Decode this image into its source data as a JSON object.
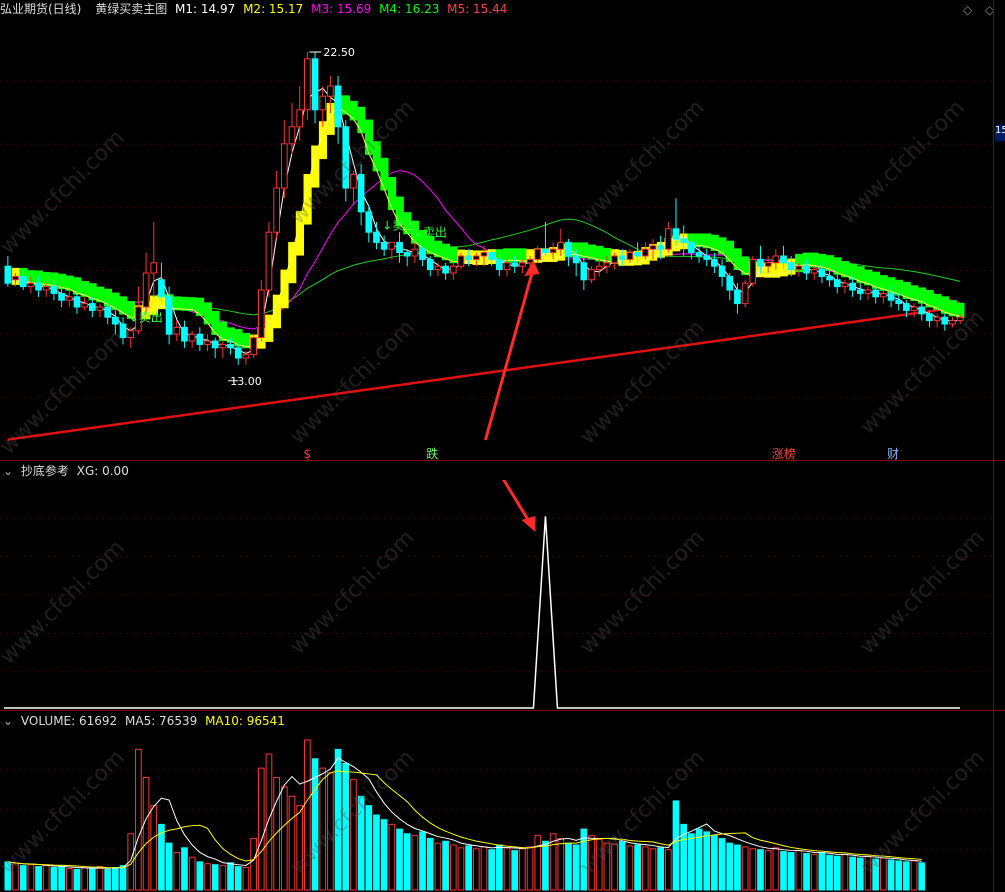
{
  "main": {
    "symbol": "弘业期货(日线)",
    "indicator": "黄绿买卖主图",
    "ma": [
      {
        "label": "M1: 14.97",
        "color": "#ffffff"
      },
      {
        "label": "M2: 15.17",
        "color": "#ffff00"
      },
      {
        "label": "M3: 15.69",
        "color": "#ff00ff"
      },
      {
        "label": "M4: 16.23",
        "color": "#00ff00"
      },
      {
        "label": "M5: 15.44",
        "color": "#ff3030"
      }
    ],
    "high_label": "22.50",
    "low_label": "13.00",
    "sell_signals": [
      {
        "text": "卖出",
        "idx": 16
      },
      {
        "text": "卖出",
        "idx": 49
      },
      {
        "text": "卖出",
        "idx": 53
      }
    ],
    "bottom_tags": [
      {
        "text": "$",
        "idx": 39,
        "color": "#ff3030"
      },
      {
        "text": "跌",
        "idx": 55,
        "color": "#66ff66"
      },
      {
        "text": "涨榜",
        "idx": 100,
        "color": "#ff4040"
      },
      {
        "text": "财",
        "idx": 115,
        "color": "#8ab4ff"
      }
    ],
    "right_edge_label": "15",
    "colors": {
      "up": "#ff3232",
      "down": "#00ffff",
      "band_yellow": "#ffff00",
      "band_green": "#00ff00"
    }
  },
  "sub1": {
    "title": "抄底参考",
    "xg_label": "XG: 0.00"
  },
  "volume": {
    "label": "VOLUME: 61692",
    "ma5": "MA5: 76539",
    "ma10": "MA10: 96541"
  },
  "chart_data": [
    {
      "type": "candlestick",
      "title": "黄绿买卖主图",
      "ylim": [
        10.5,
        23.5
      ],
      "candles": [
        [
          16.2,
          16.5,
          15.7,
          15.6
        ],
        [
          15.8,
          16.0,
          15.9,
          15.6
        ],
        [
          15.9,
          16.1,
          15.6,
          15.5
        ],
        [
          15.6,
          15.9,
          15.7,
          15.4
        ],
        [
          15.7,
          15.9,
          15.5,
          15.3
        ],
        [
          15.5,
          15.7,
          15.6,
          15.3
        ],
        [
          15.6,
          15.8,
          15.4,
          15.2
        ],
        [
          15.4,
          15.6,
          15.2,
          15.0
        ],
        [
          15.2,
          15.5,
          15.3,
          15.0
        ],
        [
          15.3,
          15.4,
          15.0,
          14.8
        ],
        [
          15.0,
          15.3,
          15.1,
          14.9
        ],
        [
          15.1,
          15.3,
          14.9,
          14.7
        ],
        [
          14.9,
          15.1,
          15.0,
          14.7
        ],
        [
          15.0,
          15.2,
          14.7,
          14.5
        ],
        [
          14.7,
          14.9,
          14.5,
          14.2
        ],
        [
          14.5,
          14.7,
          14.1,
          13.9
        ],
        [
          14.1,
          14.4,
          14.3,
          13.8
        ],
        [
          14.3,
          15.6,
          15.0,
          14.2
        ],
        [
          15.0,
          16.6,
          16.0,
          14.8
        ],
        [
          16.0,
          17.5,
          16.3,
          15.3
        ],
        [
          15.8,
          16.3,
          15.3,
          15.1
        ],
        [
          15.3,
          15.6,
          14.2,
          13.9
        ],
        [
          14.2,
          14.6,
          14.4,
          14.0
        ],
        [
          14.4,
          14.6,
          14.0,
          13.8
        ],
        [
          14.0,
          14.3,
          14.2,
          13.8
        ],
        [
          14.2,
          14.4,
          13.9,
          13.7
        ],
        [
          13.9,
          14.2,
          14.0,
          13.7
        ],
        [
          14.0,
          14.1,
          13.8,
          13.5
        ],
        [
          13.8,
          14.0,
          13.9,
          13.5
        ],
        [
          13.9,
          14.1,
          13.8,
          13.6
        ],
        [
          13.8,
          13.9,
          13.5,
          13.3
        ],
        [
          13.5,
          13.7,
          13.6,
          13.3
        ],
        [
          13.6,
          14.2,
          14.1,
          13.5
        ],
        [
          14.1,
          15.8,
          15.5,
          14.0
        ],
        [
          15.5,
          17.5,
          17.2,
          15.3
        ],
        [
          17.2,
          19.0,
          18.5,
          17.0
        ],
        [
          18.5,
          20.5,
          19.8,
          18.2
        ],
        [
          19.8,
          21.0,
          20.3,
          19.5
        ],
        [
          20.3,
          21.5,
          20.8,
          19.9
        ],
        [
          20.8,
          22.5,
          22.3,
          20.5
        ],
        [
          22.3,
          22.5,
          20.8,
          20.4
        ],
        [
          20.8,
          21.5,
          21.2,
          20.3
        ],
        [
          21.2,
          21.8,
          21.5,
          20.7
        ],
        [
          21.5,
          21.8,
          20.3,
          19.8
        ],
        [
          20.3,
          20.5,
          18.5,
          18.1
        ],
        [
          18.5,
          19.0,
          18.9,
          18.0
        ],
        [
          18.9,
          19.2,
          17.8,
          17.4
        ],
        [
          17.8,
          18.0,
          17.2,
          16.9
        ],
        [
          17.2,
          17.5,
          16.9,
          16.7
        ],
        [
          16.9,
          17.1,
          16.7,
          16.5
        ],
        [
          16.7,
          16.9,
          16.9,
          16.4
        ],
        [
          16.9,
          17.2,
          16.6,
          16.3
        ],
        [
          16.6,
          16.7,
          16.5,
          16.2
        ],
        [
          16.5,
          16.9,
          16.7,
          16.3
        ],
        [
          16.7,
          16.8,
          16.4,
          16.2
        ],
        [
          16.4,
          16.5,
          16.1,
          15.9
        ],
        [
          16.1,
          16.3,
          16.2,
          15.9
        ],
        [
          16.2,
          16.3,
          16.0,
          15.8
        ],
        [
          16.0,
          16.3,
          16.2,
          15.8
        ],
        [
          16.2,
          16.6,
          16.5,
          16.1
        ],
        [
          16.5,
          16.7,
          16.4,
          16.2
        ],
        [
          16.4,
          16.6,
          16.5,
          16.2
        ],
        [
          16.5,
          16.8,
          16.6,
          16.2
        ],
        [
          16.6,
          16.7,
          16.4,
          16.2
        ],
        [
          16.4,
          16.6,
          16.1,
          15.9
        ],
        [
          16.1,
          16.4,
          16.3,
          15.9
        ],
        [
          16.3,
          16.5,
          16.2,
          16.0
        ],
        [
          16.2,
          16.4,
          16.3,
          16.0
        ],
        [
          16.3,
          16.5,
          16.4,
          16.1
        ],
        [
          16.4,
          16.8,
          16.7,
          16.3
        ],
        [
          16.7,
          17.5,
          16.6,
          16.5
        ],
        [
          16.6,
          16.9,
          16.7,
          16.4
        ],
        [
          16.7,
          17.3,
          16.9,
          16.5
        ],
        [
          16.9,
          17.0,
          16.5,
          16.2
        ],
        [
          16.5,
          16.7,
          16.3,
          15.9
        ],
        [
          16.3,
          16.5,
          15.8,
          15.5
        ],
        [
          15.8,
          16.2,
          16.1,
          15.7
        ],
        [
          16.1,
          16.4,
          16.2,
          15.9
        ],
        [
          16.2,
          16.5,
          16.3,
          16.0
        ],
        [
          16.3,
          16.6,
          16.5,
          16.1
        ],
        [
          16.5,
          16.7,
          16.4,
          16.2
        ],
        [
          16.4,
          16.7,
          16.6,
          16.3
        ],
        [
          16.6,
          16.9,
          16.5,
          16.3
        ],
        [
          16.5,
          16.9,
          16.7,
          16.4
        ],
        [
          16.7,
          17.0,
          16.8,
          16.4
        ],
        [
          16.8,
          17.1,
          16.7,
          16.4
        ],
        [
          16.7,
          17.5,
          17.3,
          16.6
        ],
        [
          17.3,
          18.2,
          17.0,
          16.8
        ],
        [
          17.0,
          17.4,
          16.9,
          16.5
        ],
        [
          16.9,
          17.1,
          16.6,
          16.4
        ],
        [
          16.6,
          16.8,
          16.5,
          16.3
        ],
        [
          16.5,
          16.7,
          16.4,
          16.2
        ],
        [
          16.4,
          16.6,
          16.2,
          16.0
        ],
        [
          16.2,
          16.4,
          15.9,
          15.6
        ],
        [
          15.9,
          16.0,
          15.5,
          15.2
        ],
        [
          15.5,
          15.7,
          15.1,
          14.8
        ],
        [
          15.1,
          15.8,
          15.7,
          15.0
        ],
        [
          15.7,
          16.5,
          16.4,
          15.6
        ],
        [
          16.4,
          16.8,
          16.2,
          16.0
        ],
        [
          16.2,
          16.5,
          16.3,
          16.0
        ],
        [
          16.3,
          16.7,
          16.5,
          16.1
        ],
        [
          16.5,
          16.8,
          16.3,
          16.1
        ],
        [
          16.3,
          16.5,
          16.1,
          15.9
        ],
        [
          16.1,
          16.3,
          16.2,
          15.9
        ],
        [
          16.2,
          16.4,
          16.0,
          15.8
        ],
        [
          16.0,
          16.2,
          16.1,
          15.8
        ],
        [
          16.1,
          16.3,
          15.9,
          15.7
        ],
        [
          15.9,
          16.1,
          15.8,
          15.6
        ],
        [
          15.8,
          16.0,
          15.6,
          15.4
        ],
        [
          15.6,
          15.8,
          15.7,
          15.4
        ],
        [
          15.7,
          15.9,
          15.5,
          15.3
        ],
        [
          15.5,
          15.7,
          15.4,
          15.2
        ],
        [
          15.4,
          15.6,
          15.5,
          15.2
        ],
        [
          15.5,
          15.7,
          15.3,
          15.1
        ],
        [
          15.3,
          15.5,
          15.4,
          15.1
        ],
        [
          15.4,
          15.6,
          15.2,
          15.0
        ],
        [
          15.2,
          15.4,
          15.1,
          14.9
        ],
        [
          15.1,
          15.2,
          14.9,
          14.7
        ],
        [
          14.9,
          15.1,
          15.0,
          14.7
        ],
        [
          15.0,
          15.2,
          14.8,
          14.6
        ],
        [
          14.8,
          14.9,
          14.6,
          14.4
        ],
        [
          14.6,
          14.8,
          14.7,
          14.4
        ],
        [
          14.7,
          14.8,
          14.5,
          14.3
        ],
        [
          14.5,
          14.7,
          14.6,
          14.4
        ],
        [
          14.6,
          14.8,
          14.7,
          14.5
        ]
      ]
    },
    {
      "type": "line",
      "title": "抄底参考",
      "series": [
        {
          "name": "XG",
          "values_spike_index": 70,
          "peak": 1.0
        }
      ],
      "ylim": [
        0,
        1.2
      ]
    },
    {
      "type": "bar",
      "title": "VOLUME",
      "ylim": [
        0,
        160000
      ],
      "values": [
        30000,
        28000,
        26000,
        27000,
        25000,
        26000,
        24000,
        25000,
        23000,
        22000,
        24000,
        23000,
        25000,
        22000,
        24000,
        26000,
        60000,
        150000,
        120000,
        90000,
        70000,
        50000,
        40000,
        45000,
        35000,
        30000,
        28000,
        27000,
        26000,
        29000,
        25000,
        24000,
        55000,
        130000,
        145000,
        120000,
        110000,
        100000,
        90000,
        160000,
        140000,
        130000,
        125000,
        150000,
        135000,
        118000,
        100000,
        90000,
        80000,
        75000,
        70000,
        65000,
        60000,
        58000,
        62000,
        55000,
        50000,
        52000,
        48000,
        45000,
        47000,
        44000,
        46000,
        43000,
        48000,
        45000,
        42000,
        44000,
        46000,
        58000,
        52000,
        60000,
        55000,
        50000,
        48000,
        65000,
        58000,
        54000,
        50000,
        49000,
        52000,
        47000,
        48000,
        46000,
        44000,
        45000,
        43000,
        95000,
        70000,
        60000,
        65000,
        62000,
        58000,
        55000,
        50000,
        48000,
        46000,
        44000,
        43000,
        42000,
        45000,
        41000,
        40000,
        42000,
        39000,
        38000,
        40000,
        37000,
        36000,
        38000,
        35000,
        34000,
        36000,
        33000,
        34000,
        32000,
        31000,
        30000,
        31000,
        29000
      ]
    }
  ]
}
